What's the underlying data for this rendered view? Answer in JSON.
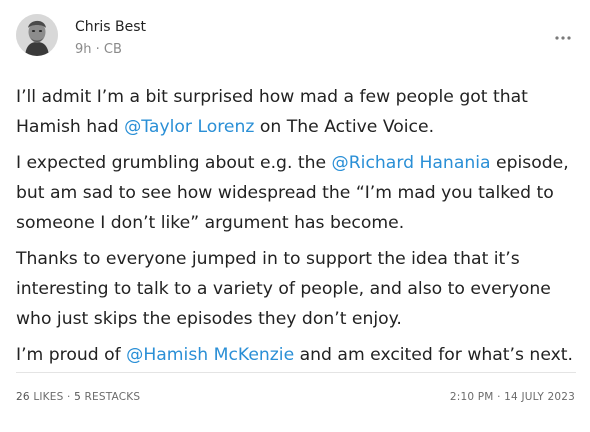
{
  "author": {
    "name": "Chris Best",
    "meta": "9h · CB"
  },
  "post": {
    "p1": {
      "l1": "I’ll admit I’m a bit surprised how mad a few people got that",
      "l2a": "Hamish had ",
      "m1": "@Taylor Lorenz",
      "l2b": " on The Active Voice."
    },
    "p2": {
      "l1a": "I expected grumbling about e.g. the ",
      "m2": "@Richard Hanania",
      "l1b": " episode,",
      "l2": "but am sad to see how widespread the “I’m mad you talked to",
      "l3": "someone I don’t like” argument has become."
    },
    "p3": {
      "l1": "Thanks to everyone jumped in to support the idea that it’s",
      "l2": "interesting to talk to a variety of people, and also to everyone",
      "l3": "who just skips the episodes they don’t enjoy."
    },
    "p4": {
      "l1a": "I’m proud of ",
      "m3": "@Hamish McKenzie",
      "l1b": " and am excited for what’s next."
    }
  },
  "stats": {
    "likes_count": "26",
    "likes_label": "LIKES",
    "sep": "·",
    "restacks_count": "5",
    "restacks_label": "RESTACKS"
  },
  "timestamp": "2:10 PM · 14 JULY 2023",
  "colors": {
    "mention": "#2a8fd6",
    "text": "#222222",
    "muted": "#8a8a8a"
  },
  "icons": {
    "avatar": "portrait-avatar",
    "more": "more-horizontal-icon"
  }
}
